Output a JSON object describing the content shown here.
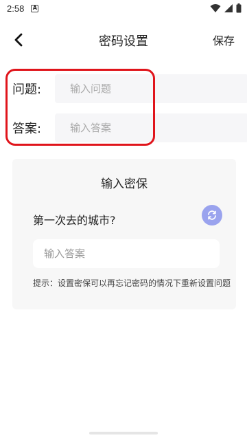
{
  "status": {
    "time": "2:58",
    "app_badge": "A"
  },
  "header": {
    "title": "密码设置",
    "save_label": "保存"
  },
  "form": {
    "question_label": "问题:",
    "question_placeholder": "输入问题",
    "answer_label": "答案:",
    "answer_placeholder": "输入答案"
  },
  "card": {
    "title": "输入密保",
    "question": "第一次去的城市?",
    "answer_placeholder": "输入答案",
    "hint": "提示：设置密保可以再忘记密码的情况下重新设置问题"
  },
  "colors": {
    "highlight": "#e0141b",
    "refresh_button": "#9aa3ee"
  },
  "icons": {
    "back": "chevron-left-icon",
    "refresh": "refresh-icon"
  }
}
